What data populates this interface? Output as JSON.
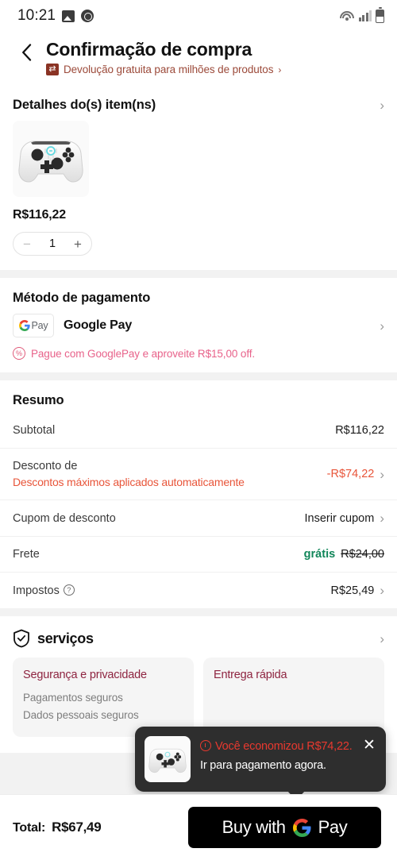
{
  "status_bar": {
    "time": "10:21",
    "icons": [
      "photo-icon",
      "clock-badge-icon",
      "wifi-icon",
      "cellular-signal-icon",
      "battery-icon"
    ]
  },
  "header": {
    "back_icon": "chevron-left-icon",
    "title": "Confirmação de compra",
    "return_badge_icon": "return-arrows-icon",
    "return_text": "Devolução gratuita para milhões de produtos",
    "return_chevron": "›"
  },
  "item_details": {
    "title": "Detalhes do(s) item(ns)",
    "chevron": "›",
    "product_image": "game-controller-image",
    "price": "R$116,22",
    "stepper": {
      "minus": "−",
      "quantity": "1",
      "plus": "+"
    }
  },
  "payment": {
    "title": "Método de pagamento",
    "logo_letter": "G",
    "logo_text": "Pay",
    "method_name": "Google Pay",
    "chevron": "›",
    "promo_icon": "percent-badge-icon",
    "promo_text": "Pague com GooglePay e aproveite R$15,00 off."
  },
  "summary": {
    "title": "Resumo",
    "rows": [
      {
        "label": "Subtotal",
        "value": "R$116,22"
      },
      {
        "label": "Desconto de",
        "sublabel": "Descontos máximos aplicados automaticamente",
        "value": "-R$74,22",
        "chevron": "›"
      },
      {
        "label": "Cupom de desconto",
        "value": "Inserir cupom",
        "chevron": "›"
      },
      {
        "label": "Frete",
        "value_free": "grátis",
        "value_struck": "R$24,00"
      },
      {
        "label": "Impostos",
        "help_icon": "question-mark-icon",
        "value": "R$25,49",
        "chevron": "›"
      }
    ]
  },
  "services": {
    "shield_icon": "shield-check-icon",
    "title": "serviços",
    "chevron": "›",
    "cards": [
      {
        "title": "Segurança e privacidade",
        "bullets": [
          "Pagamentos seguros",
          "Dados pessoais seguros"
        ]
      },
      {
        "title": "Entrega rápida",
        "bullets": []
      }
    ]
  },
  "toast": {
    "thumb_image": "game-controller-image",
    "clock_icon": "clock-icon",
    "highlight": "Você economizou R$74,22.",
    "message": " Ir para pagamento agora.",
    "close_icon": "✕"
  },
  "bottom_bar": {
    "total_label": "Total:",
    "total_value": "R$67,49",
    "buy_text": "Buy with",
    "buy_logo_letter": "G",
    "buy_pay": "Pay"
  },
  "colors": {
    "accent_red": "#e8553a",
    "promo_pink": "#e8628a",
    "free_green": "#12865a",
    "brand_maroon": "#8e2440",
    "toast_bg": "#2e2e2e",
    "toast_red": "#e8392f",
    "page_bg": "#f2f2f2"
  }
}
